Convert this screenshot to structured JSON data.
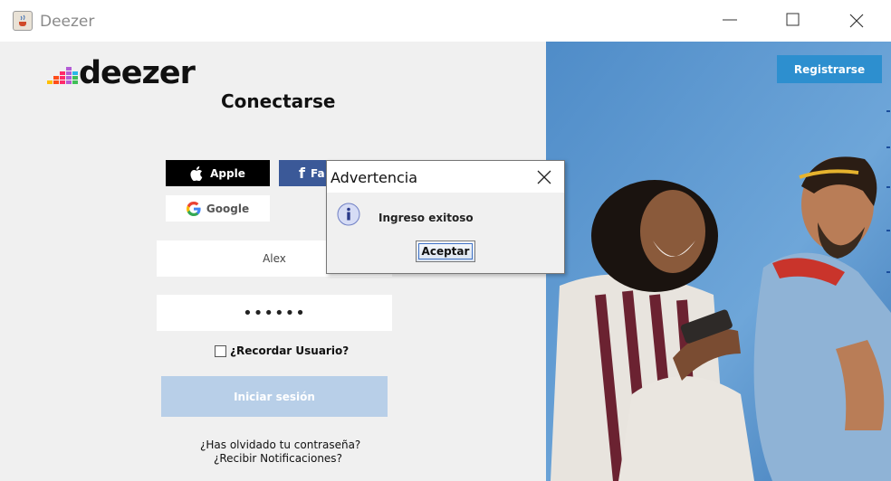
{
  "window": {
    "title": "Deezer"
  },
  "brand": {
    "name": "deezer"
  },
  "login": {
    "heading": "Conectarse",
    "apple_label": "Apple",
    "facebook_label": "Fa",
    "google_label": "Google",
    "username_value": "Alex",
    "password_value": "••••••",
    "remember_label": "¿Recordar Usuario?",
    "login_button": "Iniciar sesión",
    "forgot_password": "¿Has olvidado tu contraseña?",
    "notifications": "¿Recibir Notificaciones?"
  },
  "register_button": "Registrarse",
  "dialog": {
    "title": "Advertencia",
    "message": "Ingreso exitoso",
    "ok_button": "Aceptar"
  },
  "colors": {
    "apple": "#000000",
    "facebook": "#3b5998",
    "register": "#2d8fcf",
    "login_disabled": "#b8cfe8"
  }
}
